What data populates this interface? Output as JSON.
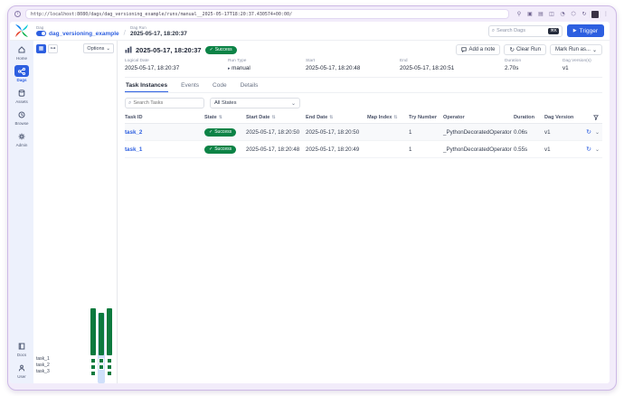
{
  "browser": {
    "url": "http://localhost:8080/dags/dag_versioning_example/runs/manual__2025-05-17T18:20:37.430574+00:00/",
    "window_icons": [
      "share-icon",
      "copy-icon",
      "tabs-icon",
      "clipboard-icon",
      "timer-icon",
      "extensions-icon",
      "refresh-icon",
      "screenshot-icon",
      "menu-icon"
    ]
  },
  "navbar": {
    "dag_label": "Dag",
    "dag_name": "dag_versioning_example",
    "breadcrumb_separator": "/",
    "run_label": "Dag Run",
    "run_name": "2025-05-17, 18:20:37",
    "search_placeholder": "Search Dags",
    "search_shortcut": "⌘K",
    "trigger_label": "Trigger"
  },
  "sidebar": {
    "items": [
      {
        "label": "Home",
        "icon": "home-icon",
        "active": false
      },
      {
        "label": "Dags",
        "icon": "dags-icon",
        "active": true
      },
      {
        "label": "Assets",
        "icon": "assets-icon",
        "active": false
      },
      {
        "label": "Browse",
        "icon": "browse-icon",
        "active": false
      },
      {
        "label": "Admin",
        "icon": "admin-icon",
        "active": false
      }
    ],
    "bottom_items": [
      {
        "label": "Docs",
        "icon": "docs-icon"
      },
      {
        "label": "User",
        "icon": "user-icon"
      }
    ]
  },
  "grid_panel": {
    "options_label": "Options",
    "tasks": [
      "task_1",
      "task_2",
      "task_3"
    ],
    "runs": [
      {
        "bar_height_pct": 100,
        "cells": [
          true,
          true,
          true
        ],
        "selected": false
      },
      {
        "bar_height_pct": 90,
        "cells": [
          true,
          true,
          false
        ],
        "selected": true
      },
      {
        "bar_height_pct": 100,
        "cells": [
          true,
          true,
          true
        ],
        "selected": false
      }
    ]
  },
  "run_header": {
    "title": "2025-05-17, 18:20:37",
    "state": "Success",
    "state_check": "✓",
    "add_note_label": "Add a note",
    "clear_run_label": "Clear Run",
    "mark_run_label": "Mark Run as..."
  },
  "run_details": {
    "logical_date": {
      "label": "Logical Date",
      "value": "2025-05-17, 18:20:37"
    },
    "run_type": {
      "label": "Run Type",
      "value": "manual"
    },
    "start": {
      "label": "Start",
      "value": "2025-05-17, 18:20:48"
    },
    "end": {
      "label": "End",
      "value": "2025-05-17, 18:20:51"
    },
    "duration": {
      "label": "Duration",
      "value": "2.70s"
    },
    "dag_versions": {
      "label": "Dag Version(s)",
      "value": "v1"
    }
  },
  "tabs": {
    "items": [
      {
        "label": "Task Instances",
        "active": true
      },
      {
        "label": "Events",
        "active": false
      },
      {
        "label": "Code",
        "active": false
      },
      {
        "label": "Details",
        "active": false
      }
    ]
  },
  "filters": {
    "search_placeholder": "Search Tasks",
    "state_filter_value": "All States"
  },
  "table": {
    "headers": {
      "task_id": "Task ID",
      "state": "State",
      "start_date": "Start Date",
      "end_date": "End Date",
      "map_index": "Map Index",
      "try_number": "Try Number",
      "operator": "Operator",
      "duration": "Duration",
      "dag_version": "Dag Version"
    },
    "rows": [
      {
        "task_id": "task_2",
        "state": "Success",
        "start_date": "2025-05-17, 18:20:50",
        "end_date": "2025-05-17, 18:20:50",
        "map_index": "",
        "try_number": "1",
        "operator": "_PythonDecoratedOperator",
        "duration": "0.06s",
        "dag_version": "v1"
      },
      {
        "task_id": "task_1",
        "state": "Success",
        "start_date": "2025-05-17, 18:20:48",
        "end_date": "2025-05-17, 18:20:49",
        "map_index": "",
        "try_number": "1",
        "operator": "_PythonDecoratedOperator",
        "duration": "0.55s",
        "dag_version": "v1"
      }
    ]
  },
  "colors": {
    "accent": "#2d5fe0",
    "success": "#0c8346",
    "bar_green": "#0b7a3e",
    "selected_column": "#cfdffa",
    "sidebar_bg": "#edf1fc",
    "frame": "#f2ecfa",
    "frame_border": "#cdb9e6",
    "logo_blue": "#017cee",
    "logo_teal": "#00c7d4",
    "logo_green": "#00ad46",
    "logo_red": "#e43921"
  }
}
